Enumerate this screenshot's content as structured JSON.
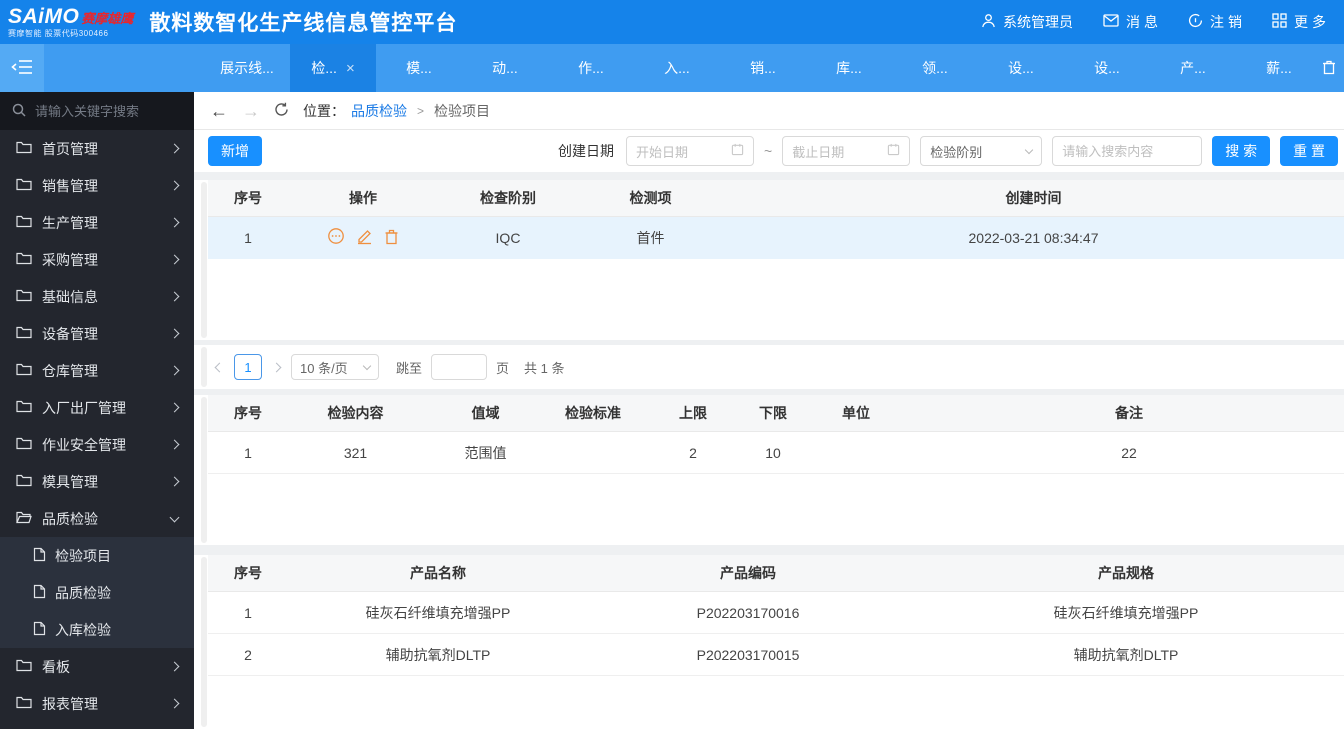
{
  "colors": {
    "accent": "#1890ff",
    "topbar": "#1583ea",
    "tabbar": "#3f9cf1",
    "sidebar": "#23262e",
    "link": "#1a7ae5",
    "op_orange": "#ef8f3f",
    "selected_row": "#e7f3fd"
  },
  "header": {
    "logo": {
      "brand": "SAiMO",
      "brand_cn": "赛摩雄鹰",
      "tagline": "赛摩智能 股票代码300466"
    },
    "title": "散料数智化生产线信息管控平台",
    "actions": {
      "user": "系统管理员",
      "message": "消息",
      "logout": "注销",
      "more": "更多"
    }
  },
  "tabbar": {
    "tabs": [
      "展示线...",
      "检...",
      "模...",
      "动...",
      "作...",
      "入...",
      "销...",
      "库...",
      "领...",
      "设...",
      "设...",
      "产...",
      "薪..."
    ],
    "close": "×"
  },
  "sidebar": {
    "search_placeholder": "请输入关键字搜索",
    "items": [
      {
        "label": "首页管理"
      },
      {
        "label": "销售管理"
      },
      {
        "label": "生产管理"
      },
      {
        "label": "采购管理"
      },
      {
        "label": "基础信息"
      },
      {
        "label": "设备管理"
      },
      {
        "label": "仓库管理"
      },
      {
        "label": "入厂出厂管理"
      },
      {
        "label": "作业安全管理"
      },
      {
        "label": "模具管理"
      },
      {
        "label": "品质检验",
        "children": [
          "检验项目",
          "品质检验",
          "入库检验"
        ]
      },
      {
        "label": "看板"
      },
      {
        "label": "报表管理"
      }
    ]
  },
  "breadcrumb": {
    "back": "←",
    "forward": "→",
    "location_label": "位置：",
    "parent": "品质检验",
    "sep": ">",
    "current": "检验项目"
  },
  "toolbar": {
    "add_label": "新增",
    "date_label": "创建日期",
    "start_placeholder": "开始日期",
    "tilde": "~",
    "end_placeholder": "截止日期",
    "stage_placeholder": "检验阶别",
    "search_placeholder": "请输入搜索内容",
    "search_label": "搜 索",
    "reset_label": "重 置"
  },
  "tables": {
    "t1": {
      "headers": [
        "序号",
        "操作",
        "检查阶别",
        "检测项",
        "创建时间"
      ],
      "rows": [
        [
          "1",
          "IQC",
          "首件",
          "2022-03-21 08:34:47"
        ]
      ]
    },
    "t2": {
      "headers": [
        "序号",
        "检验内容",
        "值域",
        "检验标准",
        "上限",
        "下限",
        "单位",
        "备注"
      ],
      "rows": [
        [
          "1",
          "321",
          "范围值",
          "",
          "2",
          "10",
          "",
          "22"
        ]
      ]
    },
    "t3": {
      "headers": [
        "序号",
        "产品名称",
        "产品编码",
        "产品规格"
      ],
      "rows": [
        [
          "1",
          "硅灰石纤维填充增强PP",
          "P202203170016",
          "硅灰石纤维填充增强PP"
        ],
        [
          "2",
          "辅助抗氧剂DLTP",
          "P202203170015",
          "辅助抗氧剂DLTP"
        ]
      ]
    }
  },
  "pagination": {
    "page": "1",
    "page_size": "10 条/页",
    "jump_label": "跳至",
    "page_unit": "页",
    "total": "共 1 条"
  }
}
